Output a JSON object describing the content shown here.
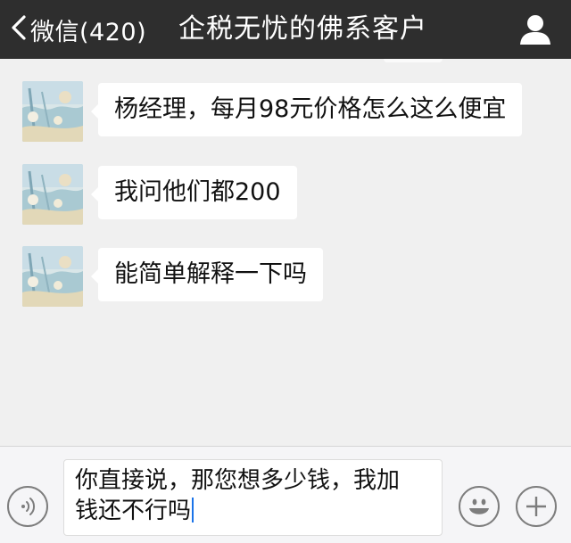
{
  "header": {
    "back_label": "微信(420)",
    "title": "企税无忧的佛系客户"
  },
  "messages": [
    {
      "text": "杨经理，每月98元价格怎么这么便宜"
    },
    {
      "text": "我问他们都200"
    },
    {
      "text": "能简单解释一下吗"
    }
  ],
  "input": {
    "line1": "你直接说，那您想多少钱，我加",
    "line2": "钱还不行吗"
  },
  "icons": {
    "back": "chevron-left-icon",
    "profile": "person-icon",
    "voice": "voice-icon",
    "emoji": "emoji-icon",
    "plus": "plus-icon"
  },
  "colors": {
    "topbar": "#2e2e2e",
    "chat_bg": "#f0f0f0",
    "bubble": "#ffffff",
    "caret": "#1a73e8"
  }
}
